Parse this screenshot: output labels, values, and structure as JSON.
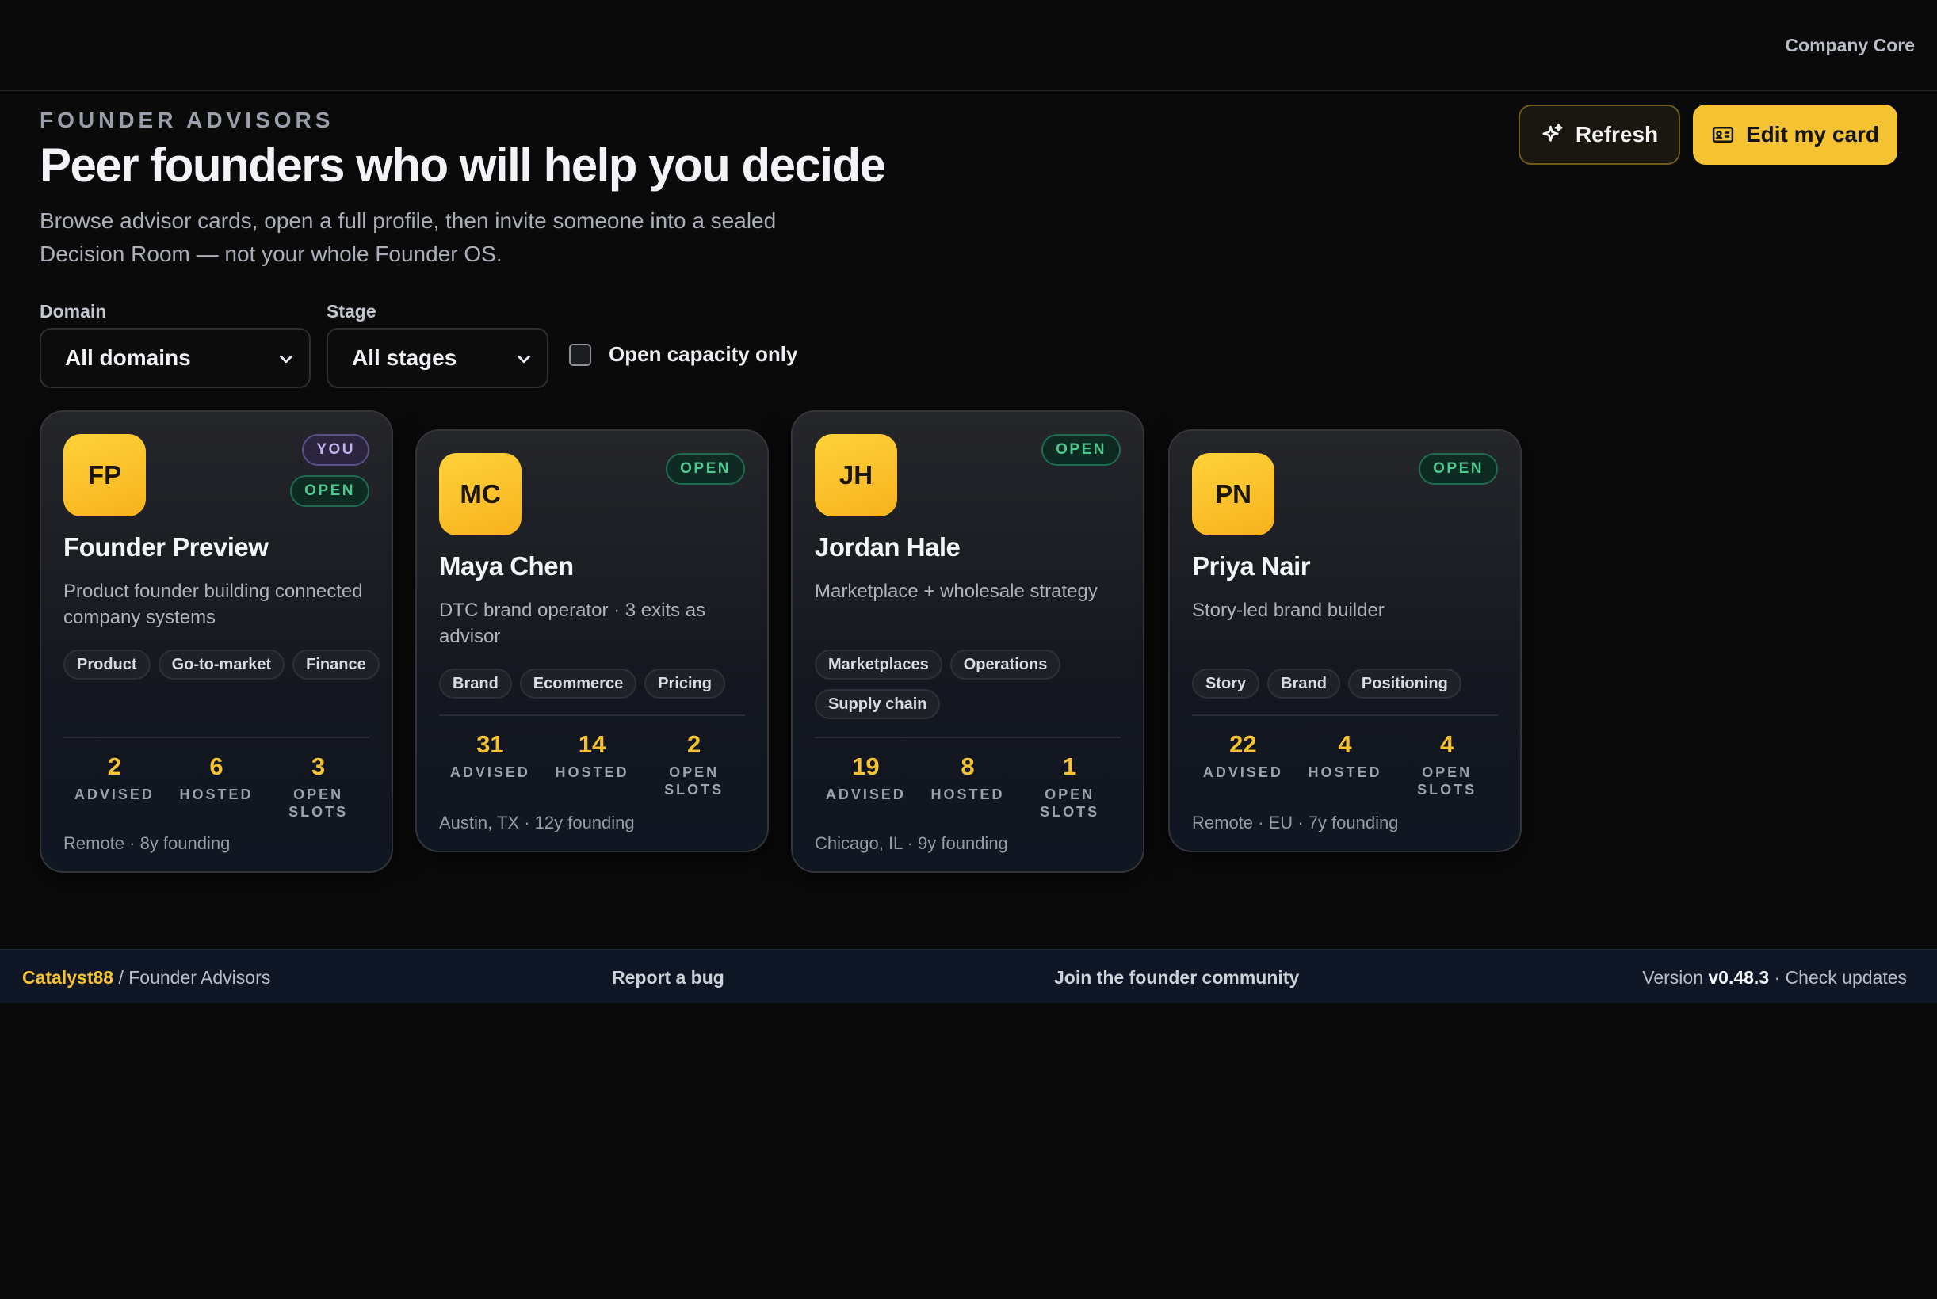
{
  "topbar": {
    "app_label": "Company Core"
  },
  "header": {
    "eyebrow": "FOUNDER ADVISORS",
    "title": "Peer founders who will help you decide",
    "subtitle": "Browse advisor cards, open a full profile, then invite someone into a sealed Decision Room — not your whole Founder OS.",
    "refresh_label": "Refresh",
    "edit_label": "Edit my card"
  },
  "filters": {
    "domain_label": "Domain",
    "domain_value": "All domains",
    "stage_label": "Stage",
    "stage_value": "All stages",
    "open_capacity_label": "Open capacity only",
    "open_capacity_checked": false
  },
  "stat_labels": {
    "advised": "ADVISED",
    "hosted": "HOSTED",
    "open_slots": "OPEN SLOTS"
  },
  "advisors": [
    {
      "initials": "FP",
      "name": "Founder Preview",
      "you_badge": "YOU",
      "status": "OPEN",
      "description": "Product founder building connected company systems",
      "tags": [
        "Product",
        "Go-to-market",
        "Finance"
      ],
      "advised": "2",
      "hosted": "6",
      "open_slots": "3",
      "location": "Remote · 8y founding"
    },
    {
      "initials": "MC",
      "name": "Maya Chen",
      "status": "OPEN",
      "description": "DTC brand operator · 3 exits as advisor",
      "tags": [
        "Brand",
        "Ecommerce",
        "Pricing"
      ],
      "advised": "31",
      "hosted": "14",
      "open_slots": "2",
      "location": "Austin, TX · 12y founding"
    },
    {
      "initials": "JH",
      "name": "Jordan Hale",
      "status": "OPEN",
      "description": "Marketplace + wholesale strategy",
      "tags": [
        "Marketplaces",
        "Operations",
        "Supply chain"
      ],
      "advised": "19",
      "hosted": "8",
      "open_slots": "1",
      "location": "Chicago, IL · 9y founding"
    },
    {
      "initials": "PN",
      "name": "Priya Nair",
      "status": "OPEN",
      "description": "Story-led brand builder",
      "tags": [
        "Story",
        "Brand",
        "Positioning"
      ],
      "advised": "22",
      "hosted": "4",
      "open_slots": "4",
      "location": "Remote · EU · 7y founding"
    }
  ],
  "footer": {
    "app_name": "Catalyst88",
    "breadcrumb_sep": " / ",
    "section": "Founder Advisors",
    "report_bug": "Report a bug",
    "community": "Join the founder community",
    "version_prefix": "Version ",
    "version": "v0.48.3",
    "check_updates": " · Check updates"
  },
  "colors": {
    "accent": "#f5c232",
    "open_green": "#4cc98e",
    "you_purple": "#c2b4ef",
    "background": "#0a0a0a"
  }
}
